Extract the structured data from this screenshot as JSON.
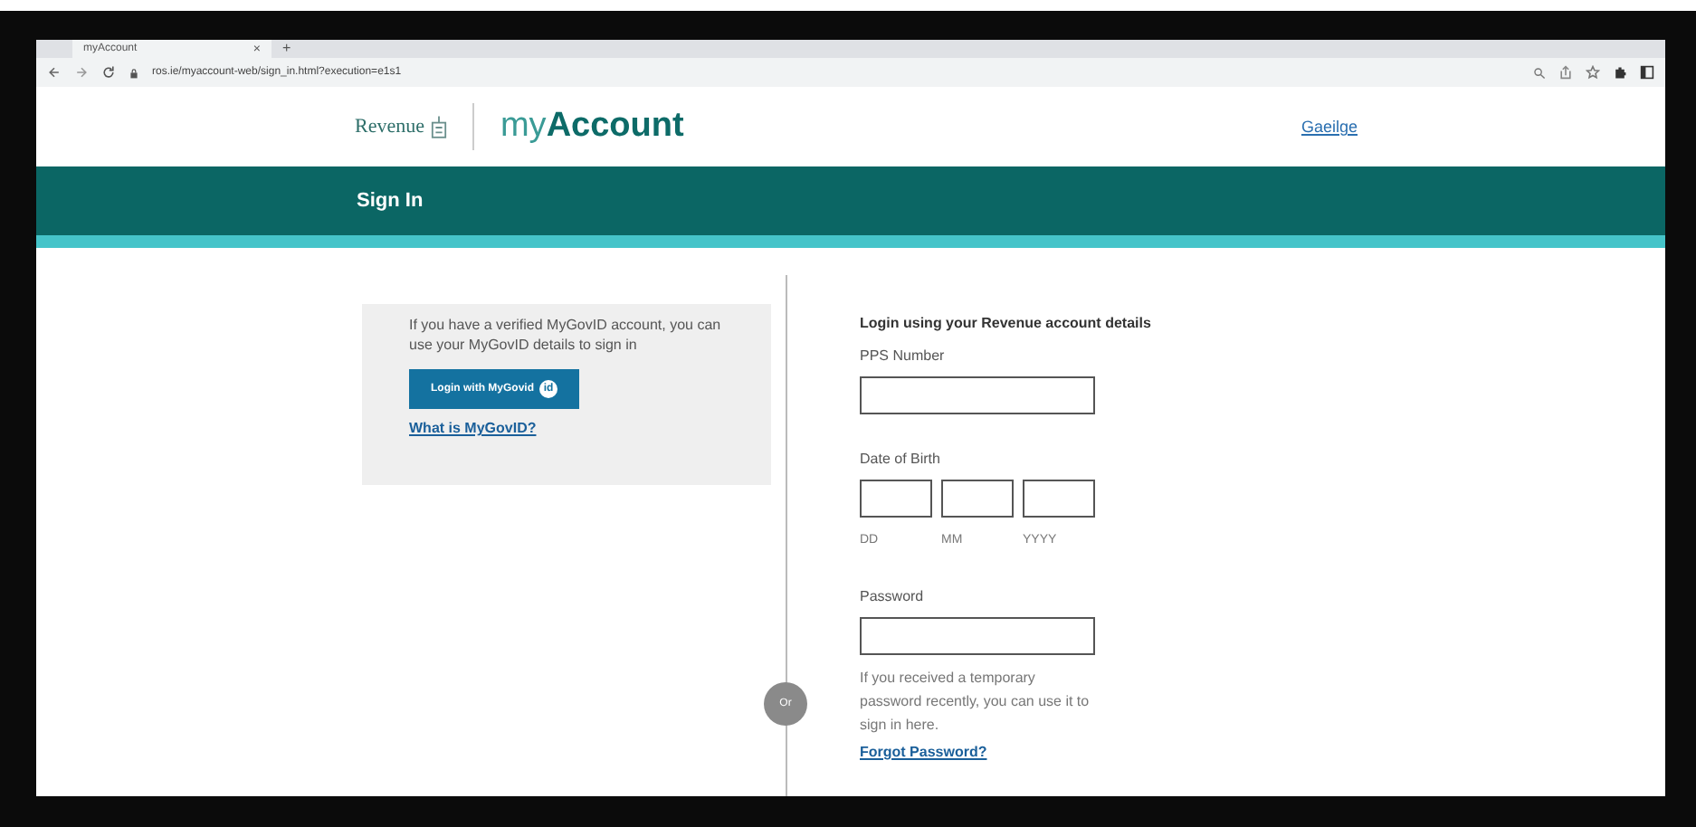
{
  "browser": {
    "tab_title": "myAccount",
    "tab_close": "×",
    "new_tab": "+",
    "url": "ros.ie/myaccount-web/sign_in.html?execution=e1s1"
  },
  "header": {
    "brand": "Revenue",
    "product_light": "my",
    "product_bold": "Account",
    "language_link": "Gaeilge"
  },
  "banner": {
    "title": "Sign In"
  },
  "mygovid": {
    "text": "If you have a verified MyGovID account, you can use your MyGovID details to sign in",
    "button": "Login with MyGovid",
    "button_badge": "id",
    "link": "What is MyGovID?"
  },
  "divider": {
    "label": "Or"
  },
  "login": {
    "heading": "Login using your Revenue account details",
    "pps_label": "PPS Number",
    "dob_label": "Date of Birth",
    "dob_parts": [
      "DD",
      "MM",
      "YYYY"
    ],
    "password_label": "Password",
    "help_text": "If you received a temporary password recently, you can use it to sign in here.",
    "forgot_link": "Forgot Password?"
  }
}
